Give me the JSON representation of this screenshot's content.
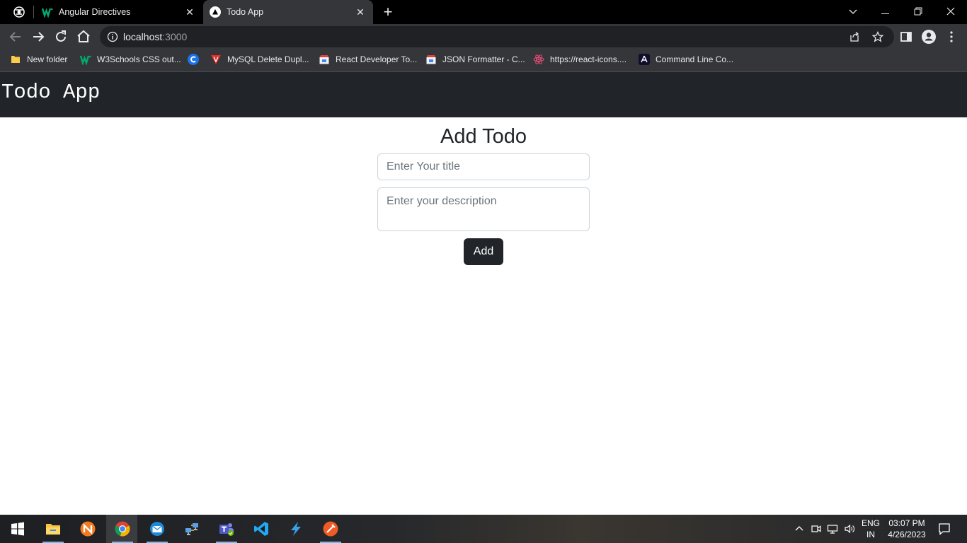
{
  "browser": {
    "tabs": [
      {
        "title": "Angular Directives",
        "favicon": "w3schools-icon",
        "active": false
      },
      {
        "title": "Todo App",
        "favicon": "react-triangle-icon",
        "active": true
      }
    ],
    "address": {
      "host": "localhost",
      "port": ":3000"
    },
    "bookmarks": [
      {
        "label": "New folder",
        "icon": "folder-icon"
      },
      {
        "label": "W3Schools CSS out...",
        "icon": "w3schools-icon"
      },
      {
        "label": "",
        "icon": "c-logo-icon"
      },
      {
        "label": "MySQL Delete Dupl...",
        "icon": "red-v-icon"
      },
      {
        "label": "React Developer To...",
        "icon": "store-icon"
      },
      {
        "label": "JSON Formatter - C...",
        "icon": "store-icon"
      },
      {
        "label": "https://react-icons....",
        "icon": "react-atom-icon"
      },
      {
        "label": "Command Line Co...",
        "icon": "angular-icon"
      }
    ]
  },
  "app": {
    "brand": "Todo App",
    "heading": "Add Todo",
    "title_placeholder": "Enter Your title",
    "description_placeholder": "Enter your description",
    "add_label": "Add"
  },
  "taskbar": {
    "language": "ENG",
    "region": "IN",
    "time": "03:07 PM",
    "date": "4/26/2023"
  },
  "colors": {
    "navbar": "#212529",
    "button": "#212529",
    "chrome_dark": "#35363a"
  }
}
